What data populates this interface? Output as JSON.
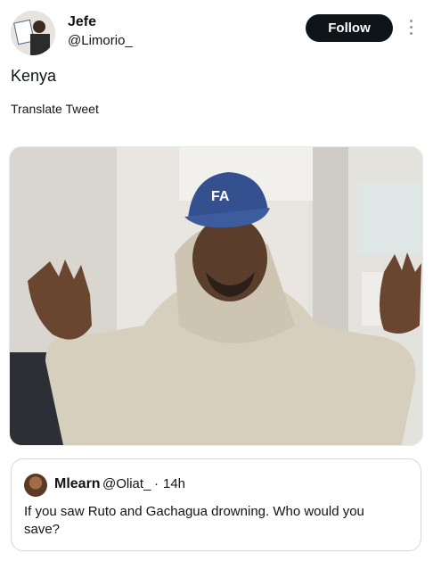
{
  "tweet": {
    "author_name": "Jefe",
    "author_handle": "@Limorio_",
    "follow_label": "Follow",
    "text": "Kenya",
    "translate_label": "Translate Tweet",
    "media_cap_text": "FA"
  },
  "quote": {
    "author_name": "Mlearn",
    "author_handle": "@Oliat_",
    "separator": "·",
    "time": "14h",
    "text": "If you saw Ruto and Gachagua drowning. Who would you save?"
  },
  "icons": {
    "more": "more-vertical-icon"
  },
  "colors": {
    "follow_bg": "#0f1419",
    "quote_border": "#cfd9de",
    "muted": "#8b98a5"
  }
}
